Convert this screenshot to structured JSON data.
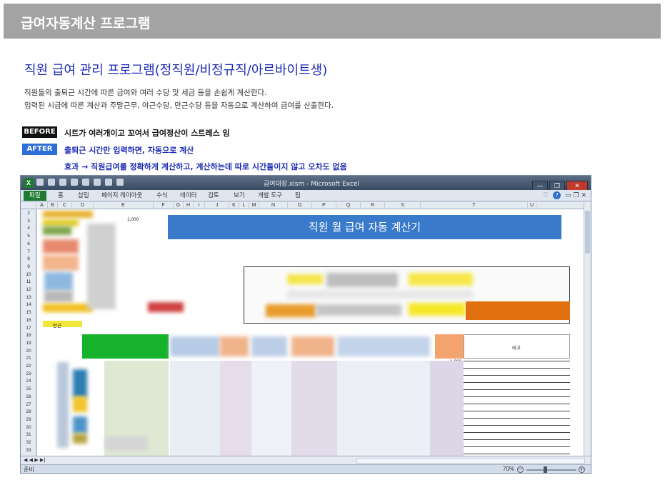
{
  "header": {
    "title": "급여자동계산 프로그램"
  },
  "intro": {
    "subtitle": "직원 급여 관리 프로그램(정직원/비정규직/아르바이트생)",
    "line1": "직원들의 출퇴근 시간에 따른 급여와 여러 수당 및 세금 등을 손쉽게 계산한다.",
    "line2": "입력된 시급에 따른 계산과 주말근무, 야근수당, 만근수당 등을 자동으로 계산하여 급여를 산출한다."
  },
  "before": {
    "tag": "BEFORE",
    "text": "시트가 여러개이고 꼬여서 급여정산이 스트레스 임"
  },
  "after": {
    "tag": "AFTER",
    "text": "출퇴근 시간만 입력하면, 자동으로 계산"
  },
  "effect": {
    "text": "효과 → 직원급여를 정확하게 계산하고, 계산하는데 따로 시간들이지 않고 오차도 없음"
  },
  "excel": {
    "window_title": "급여대장.xlsm - Microsoft Excel",
    "tabs": [
      "파일",
      "홈",
      "삽입",
      "페이지 레이아웃",
      "수식",
      "데이터",
      "검토",
      "보기",
      "개발 도구",
      "팀"
    ],
    "columns": [
      "A",
      "B",
      "C",
      "D",
      "E",
      "F",
      "G",
      "H",
      "I",
      "J",
      "K",
      "L",
      "M",
      "N",
      "O",
      "P",
      "Q",
      "R",
      "S",
      "T",
      "U"
    ],
    "rows": [
      "2",
      "3",
      "4",
      "5",
      "6",
      "7",
      "8",
      "9",
      "10",
      "11",
      "12",
      "13",
      "14",
      "15",
      "16",
      "17",
      "18",
      "19",
      "20",
      "21",
      "22",
      "23",
      "24",
      "25",
      "26",
      "27",
      "28",
      "29",
      "30",
      "31",
      "32",
      "33"
    ],
    "banner": "직원 월 급여 자동 계산기",
    "remark_header": "비고",
    "amount_value": "1,000",
    "label_17": "만근",
    "status_ready": "준비",
    "zoom": "70%",
    "window_buttons": {
      "minimize": "—",
      "restore": "❐",
      "close": "✕"
    },
    "zoom_minus": "−",
    "zoom_plus": "+",
    "tab_nav": "◀ ◀ ▶ ▶|"
  }
}
